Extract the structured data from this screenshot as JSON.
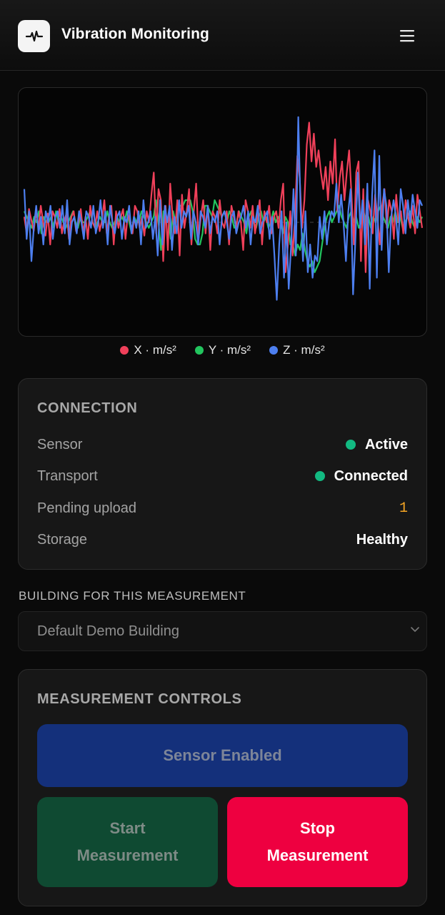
{
  "app": {
    "title": "Vibration Monitoring",
    "logo_icon": "pulse-icon",
    "menu_icon": "hamburger-menu-icon"
  },
  "chart_data": {
    "type": "line",
    "xlabel": "",
    "ylabel": "",
    "grid": false,
    "baseline": "dashed-center",
    "ylim": [
      -1,
      1
    ],
    "series": [
      {
        "name": "X · m/s²",
        "color": "#f0405a",
        "values": [
          0.05,
          -0.1,
          0.12,
          0.02,
          -0.08,
          0.1,
          -0.05,
          0.15,
          0.0,
          -0.12,
          0.08,
          -0.2,
          0.1,
          0.05,
          -0.05,
          0.12,
          -0.1,
          0.02,
          0.08,
          -0.15,
          0.05,
          0.1,
          -0.08,
          0.0,
          0.12,
          -0.1,
          0.05,
          -0.15,
          0.15,
          0.0,
          -0.05,
          0.1,
          -0.08,
          0.02,
          0.2,
          -0.1,
          0.05,
          0.15,
          -0.2,
          0.1,
          -0.05,
          0.05,
          0.12,
          -0.15,
          0.08,
          0.0,
          -0.1,
          0.15,
          0.1,
          -0.05,
          0.05,
          -0.12,
          0.1,
          0.0,
          0.25,
          0.45,
          -0.1,
          0.3,
          0.2,
          -0.35,
          0.15,
          -0.25,
          0.35,
          0.05,
          -0.1,
          0.2,
          -0.3,
          0.25,
          -0.05,
          0.1,
          0.3,
          -0.2,
          0.1,
          0.35,
          -0.15,
          0.05,
          0.2,
          -0.1,
          0.15,
          -0.25,
          0.1,
          0.05,
          -0.1,
          0.2,
          0.0,
          -0.05,
          0.1,
          -0.2,
          0.15,
          0.05,
          -0.05,
          0.1,
          0.0,
          -0.25,
          0.2,
          0.1,
          -0.05,
          0.15,
          -0.1,
          0.05,
          0.2,
          -0.2,
          0.1,
          0.0,
          0.15,
          -0.1,
          0.05,
          0.1,
          -0.05,
          0.2,
          0.35,
          -0.45,
          -0.2,
          0.1,
          -0.3,
          0.05,
          0.6,
          0.4,
          -0.05,
          0.2,
          0.7,
          0.9,
          0.55,
          0.8,
          0.5,
          0.65,
          0.45,
          0.3,
          0.5,
          0.2,
          0.55,
          0.35,
          0.75,
          0.1,
          0.4,
          0.55,
          0.2,
          0.45,
          0.65,
          0.25,
          -0.2,
          0.45,
          0.55,
          -0.35,
          0.3,
          -0.45,
          0.2,
          0.1,
          -0.1,
          0.25,
          0.05,
          -0.2,
          0.15,
          0.3,
          -0.05,
          0.2,
          0.1,
          -0.15,
          0.25,
          0.0,
          0.1,
          -0.1,
          0.2,
          0.05,
          -0.05,
          0.15,
          -0.1,
          0.25,
          0.1,
          -0.05
        ]
      },
      {
        "name": "Y · m/s²",
        "color": "#22c55e",
        "values": [
          0.1,
          0.05,
          0.0,
          -0.05,
          0.05,
          0.0,
          0.1,
          -0.1,
          0.05,
          0.0,
          0.0,
          0.05,
          -0.05,
          0.1,
          0.0,
          0.05,
          0.0,
          -0.05,
          0.0,
          0.05,
          0.1,
          0.0,
          -0.05,
          0.05,
          0.0,
          0.0,
          0.05,
          0.1,
          0.0,
          -0.05,
          0.0,
          0.05,
          0.0,
          0.0,
          0.1,
          0.0,
          -0.05,
          0.0,
          0.05,
          0.0,
          0.05,
          0.0,
          0.1,
          0.0,
          -0.1,
          0.05,
          0.0,
          0.0,
          0.1,
          0.05,
          0.0,
          -0.05,
          0.0,
          0.05,
          0.2,
          0.0,
          -0.25,
          0.1,
          0.0,
          0.05,
          -0.15,
          0.1,
          0.0,
          0.15,
          0.15,
          0.15,
          0.2,
          0.2,
          0.2,
          0.1,
          -0.15,
          -0.2,
          -0.2,
          -0.1,
          0.15,
          0.15,
          0.1,
          0.05,
          0.2,
          0.15,
          0.1,
          0.05,
          0.1,
          0.0,
          0.1,
          0.05,
          -0.05,
          0.0,
          0.1,
          0.05,
          0.0,
          -0.1,
          0.05,
          0.1,
          0.0,
          -0.05,
          0.05,
          0.1,
          0.0,
          0.05,
          -0.05,
          0.0,
          0.1,
          0.0,
          0.05,
          0.0,
          -0.1,
          0.05,
          0.0,
          -0.2,
          -0.2,
          -0.3,
          -0.2,
          -0.25,
          -0.1,
          -0.25,
          -0.35,
          -0.4,
          -0.35,
          -0.45,
          -0.4,
          -0.35,
          -0.2,
          -0.05,
          0.05,
          0.1,
          0.0,
          0.05,
          0.1,
          0.15,
          0.05,
          0.0,
          -0.05,
          0.05,
          0.1,
          0.0,
          0.05,
          -0.05,
          0.0,
          0.1,
          0.0,
          0.05,
          -0.05,
          0.05,
          0.0,
          0.1,
          0.15,
          0.05,
          0.0,
          -0.05,
          0.05,
          0.0,
          0.1,
          0.0,
          0.05,
          -0.05,
          0.0,
          0.05,
          0.1,
          0.0,
          -0.05,
          0.05,
          0.0,
          0.05
        ]
      },
      {
        "name": "Z · m/s²",
        "color": "#4d7ff0",
        "values": [
          0.3,
          -0.15,
          0.1,
          -0.35,
          -0.05,
          0.15,
          -0.1,
          0.05,
          -0.2,
          0.1,
          0.0,
          0.15,
          -0.15,
          0.05,
          0.1,
          -0.05,
          0.15,
          -0.1,
          0.2,
          -0.2,
          0.0,
          0.05,
          -0.1,
          0.1,
          0.0,
          -0.15,
          0.1,
          0.05,
          -0.05,
          0.15,
          -0.1,
          0.0,
          0.2,
          -0.05,
          0.1,
          -0.2,
          0.15,
          0.0,
          -0.1,
          0.05,
          0.1,
          -0.15,
          0.05,
          0.0,
          0.15,
          -0.1,
          0.05,
          -0.05,
          0.1,
          -0.2,
          0.2,
          -0.05,
          0.0,
          0.1,
          -0.15,
          0.05,
          -0.3,
          0.2,
          -0.2,
          0.15,
          0.0,
          0.15,
          -0.25,
          0.05,
          -0.1,
          0.2,
          -0.05,
          0.1,
          0.05,
          0.15,
          -0.15,
          0.1,
          0.0,
          -0.2,
          0.1,
          0.05,
          -0.05,
          0.15,
          -0.1,
          0.05,
          0.0,
          0.1,
          -0.2,
          0.05,
          0.1,
          0.0,
          -0.15,
          0.05,
          0.1,
          -0.1,
          0.0,
          0.05,
          0.15,
          -0.05,
          0.1,
          -0.2,
          0.05,
          0.0,
          0.15,
          -0.1,
          0.0,
          0.05,
          0.1,
          -0.15,
          0.05,
          -0.3,
          -0.7,
          -0.2,
          0.1,
          -0.5,
          0.0,
          -0.6,
          -0.2,
          0.3,
          -0.3,
          0.95,
          0.1,
          -0.35,
          0.1,
          -0.45,
          -0.2,
          -0.5,
          -0.3,
          -0.35,
          0.05,
          -0.15,
          0.1,
          -0.2,
          0.0,
          0.1,
          0.05,
          0.35,
          0.0,
          0.25,
          0.0,
          -0.35,
          0.1,
          0.3,
          -0.65,
          -0.15,
          0.45,
          -0.05,
          0.2,
          -0.2,
          0.35,
          -0.6,
          0.25,
          0.65,
          -0.5,
          0.6,
          -0.25,
          0.3,
          0.15,
          -0.45,
          0.05,
          0.2,
          0.05,
          -0.2,
          0.3,
          0.15,
          -0.1,
          0.2,
          0.0,
          0.25,
          0.1,
          -0.05,
          0.2,
          0.15
        ]
      }
    ]
  },
  "connection": {
    "title": "CONNECTION",
    "rows": [
      {
        "label": "Sensor",
        "value": "Active"
      },
      {
        "label": "Transport",
        "value": "Connected"
      },
      {
        "label": "Pending upload",
        "value": "1"
      },
      {
        "label": "Storage",
        "value": "Healthy"
      }
    ],
    "colors": {
      "ok_dot": "#12b981",
      "pending": "#f5a524"
    }
  },
  "building": {
    "label": "BUILDING FOR THIS MEASUREMENT",
    "selected": "Default Demo Building"
  },
  "controls": {
    "title": "MEASUREMENT CONTROLS",
    "sensor_button": "Sensor Enabled",
    "start_line1": "Start",
    "start_line2": "Measurement",
    "stop_line1": "Stop",
    "stop_line2": "Measurement",
    "colors": {
      "sensor": "#14307b",
      "start": "#0f4a32",
      "stop": "#ee0040"
    }
  }
}
